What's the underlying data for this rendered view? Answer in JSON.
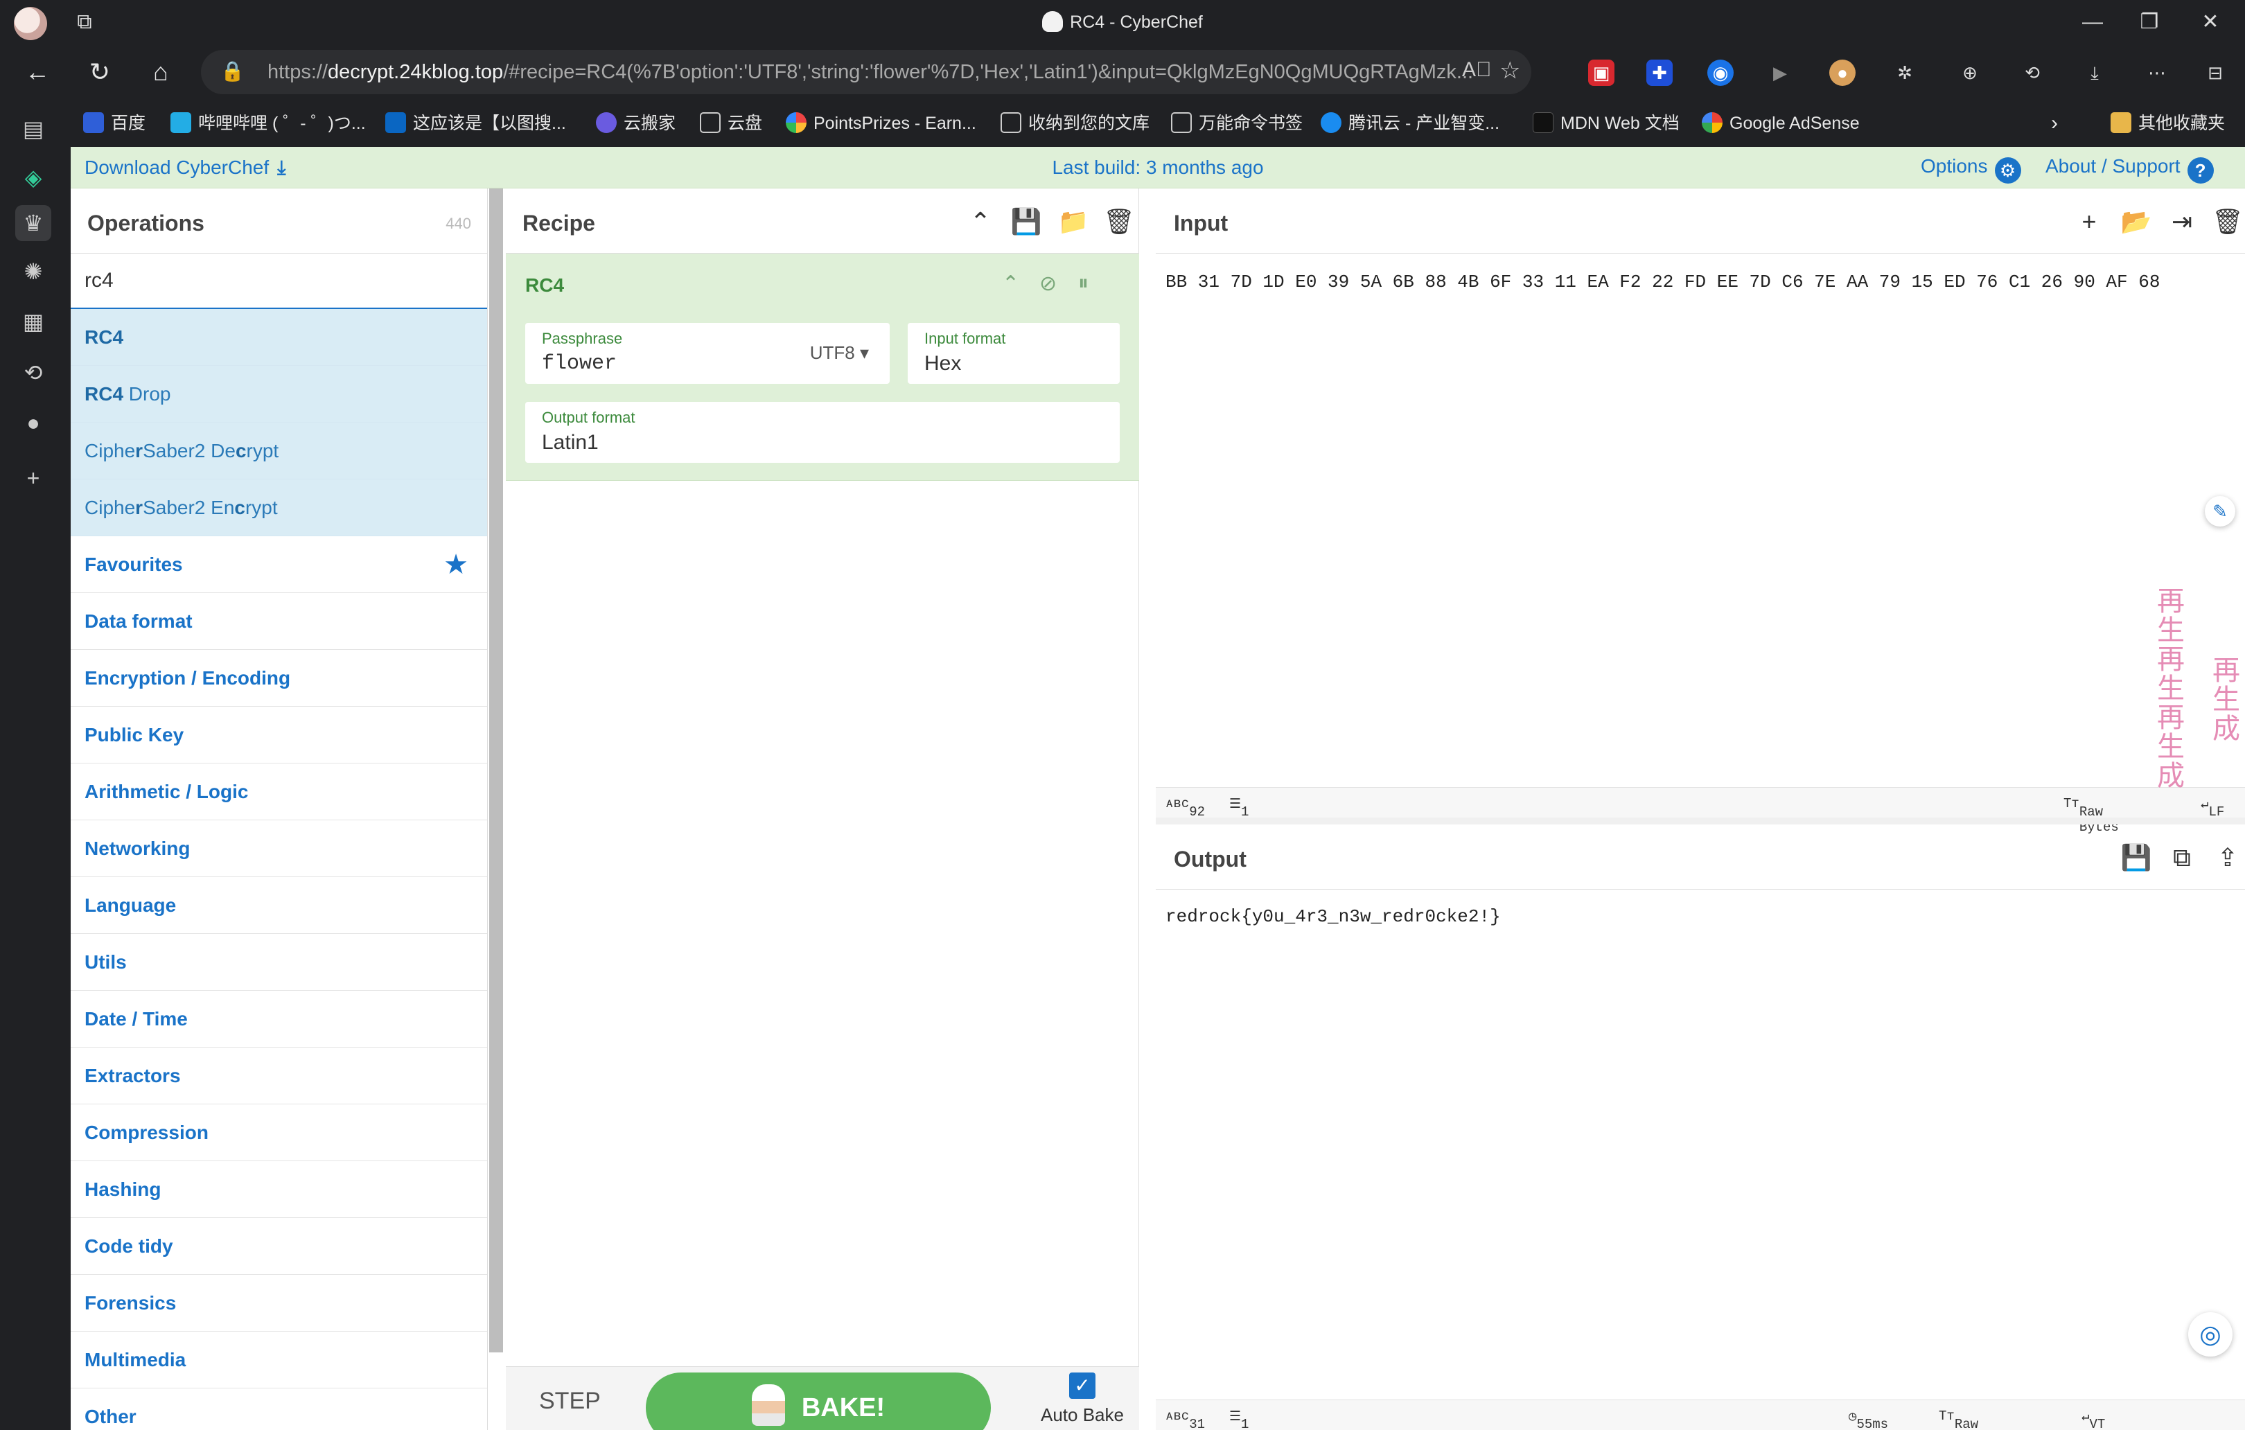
{
  "browser": {
    "window_title": "RC4 - CyberChef",
    "url_prefix": "https://",
    "url_domain": "decrypt.24kblog.top",
    "url_rest": "/#recipe=RC4(%7B'option':'UTF8','string':'flower'%7D,'Hex','Latin1')&input=QklgMzEgN0QgMUQgRTAgMzk...",
    "bookmarks": [
      "百度",
      "哔哩哔哩 ( ゜- ゜)つ...",
      "这应该是【以图搜...",
      "云搬家",
      "云盘",
      "PointsPrizes - Earn...",
      "收纳到您的文库",
      "万能命令书签",
      "腾讯云 - 产业智变...",
      "MDN Web 文档",
      "Google AdSense",
      "其他收藏夹"
    ]
  },
  "banner": {
    "download": "Download CyberChef",
    "build": "Last build: 3 months ago",
    "options": "Options",
    "about": "About / Support"
  },
  "operations": {
    "title": "Operations",
    "count": "440",
    "search_value": "rc4",
    "results": [
      {
        "bold": "RC4",
        "rest": ""
      },
      {
        "bold": "RC4",
        "rest": " Drop"
      },
      {
        "pre": "Ciphe",
        "bold": "r",
        "mid": "Saber2 De",
        "bold2": "c",
        "rest": "rypt"
      },
      {
        "pre": "Ciphe",
        "bold": "r",
        "mid": "Saber2 En",
        "bold2": "c",
        "rest": "rypt"
      }
    ],
    "categories": [
      "Favourites",
      "Data format",
      "Encryption / Encoding",
      "Public Key",
      "Arithmetic / Logic",
      "Networking",
      "Language",
      "Utils",
      "Date / Time",
      "Extractors",
      "Compression",
      "Hashing",
      "Code tidy",
      "Forensics",
      "Multimedia",
      "Other"
    ]
  },
  "recipe": {
    "title": "Recipe",
    "op_name": "RC4",
    "passphrase_label": "Passphrase",
    "passphrase_value": "flower",
    "passphrase_encoding": "UTF8",
    "input_format_label": "Input format",
    "input_format_value": "Hex",
    "output_format_label": "Output format",
    "output_format_value": "Latin1",
    "step": "STEP",
    "bake": "BAKE!",
    "auto_bake": "Auto Bake"
  },
  "input": {
    "title": "Input",
    "text": "BB 31 7D 1D E0 39 5A 6B 88 4B 6F 33 11 EA F2 22 FD EE 7D C6 7E AA 79 15 ED 76 C1 26 90 AF 68",
    "length": "92",
    "lines": "1",
    "encoding": "Raw Bytes",
    "eol": "LF"
  },
  "output": {
    "title": "Output",
    "text": "redrock{y0u_4r3_n3w_redr0cke2!}",
    "length": "31",
    "lines": "1",
    "time": "55ms",
    "encoding": "Raw Bytes",
    "eol": "VT (detected)"
  },
  "overlay": {
    "vtext1": "再生再生再生成",
    "vtext2": "再生成"
  }
}
